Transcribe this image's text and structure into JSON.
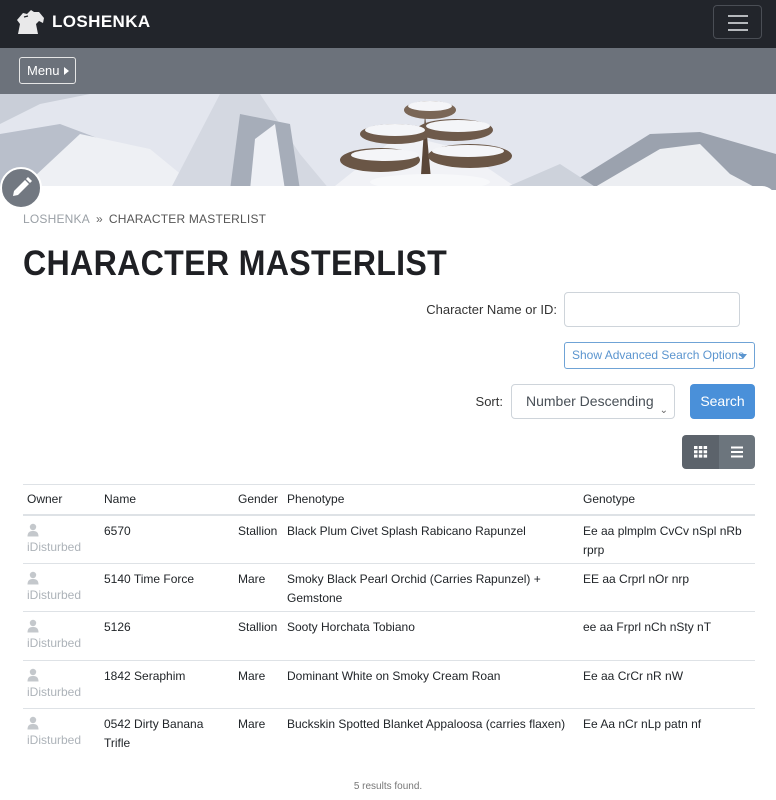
{
  "header": {
    "brand": "LOSHENKA",
    "logo_icon": "horse-head-icon",
    "menu_icon": "hamburger-icon"
  },
  "subnav": {
    "menu_label": "Menu"
  },
  "breadcrumb": {
    "home": "LOSHENKA",
    "separator": "»",
    "current": "CHARACTER MASTERLIST"
  },
  "page": {
    "title": "CHARACTER MASTERLIST"
  },
  "search": {
    "name_label": "Character Name or ID:",
    "name_value": "",
    "advanced_label": "Show Advanced Search Options",
    "sort_label": "Sort:",
    "sort_value": "Number Descending",
    "search_label": "Search"
  },
  "table": {
    "headers": {
      "owner": "Owner",
      "name": "Name",
      "gender": "Gender",
      "phenotype": "Phenotype",
      "genotype": "Genotype"
    },
    "rows": [
      {
        "owner": "iDisturbed",
        "name": "6570",
        "gender": "Stallion",
        "phenotype": "Black Plum Civet Splash Rabicano Rapunzel",
        "genotype": "Ee aa plmplm CvCv nSpl nRb rprp"
      },
      {
        "owner": "iDisturbed",
        "name": "5140 Time Force",
        "gender": "Mare",
        "phenotype": "Smoky Black Pearl Orchid (Carries Rapunzel) + Gemstone",
        "genotype": "EE aa Crprl nOr nrp"
      },
      {
        "owner": "iDisturbed",
        "name": "5126",
        "gender": "Stallion",
        "phenotype": "Sooty Horchata Tobiano",
        "genotype": "ee aa Frprl nCh nSty nT"
      },
      {
        "owner": "iDisturbed",
        "name": "1842 Seraphim",
        "gender": "Mare",
        "phenotype": "Dominant White on Smoky Cream Roan",
        "genotype": "Ee aa CrCr nR nW"
      },
      {
        "owner": "iDisturbed",
        "name": "0542 Dirty Banana Trifle",
        "gender": "Mare",
        "phenotype": "Buckskin Spotted Blanket Appaloosa (carries flaxen)",
        "genotype": "Ee Aa nCr nLp patn nf"
      }
    ]
  },
  "footer": {
    "results": "5 results found."
  },
  "colors": {
    "topbar": "#22252b",
    "subbar": "#6c727b",
    "primary": "#4a90d9",
    "link_outline": "#5b95cf"
  }
}
